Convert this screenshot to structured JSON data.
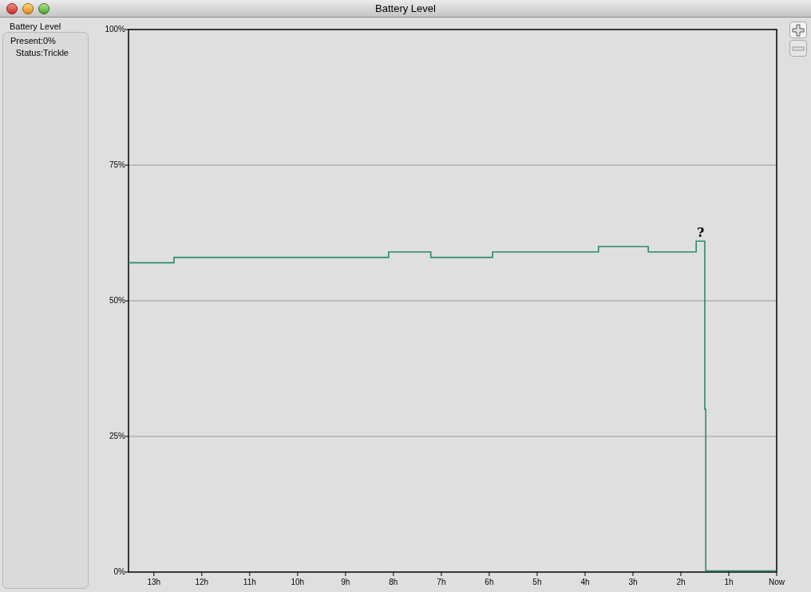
{
  "window": {
    "title": "Battery Level"
  },
  "sidebar": {
    "title": "Battery Level",
    "fields": [
      {
        "label": "Present:",
        "value": "0%"
      },
      {
        "label": "Status:",
        "value": "Trickle"
      }
    ]
  },
  "zoom_buttons": [
    {
      "kind": "zoom-in"
    },
    {
      "kind": "zoom-out"
    }
  ],
  "chart": {
    "chart_data": {
      "type": "line",
      "grid": true,
      "xlim": [
        -13.53,
        0
      ],
      "ylim": [
        0,
        100
      ],
      "xticks": [
        {
          "value": -13,
          "label": "13h"
        },
        {
          "value": -12,
          "label": "12h"
        },
        {
          "value": -11,
          "label": "11h"
        },
        {
          "value": -10,
          "label": "10h"
        },
        {
          "value": -9,
          "label": "9h"
        },
        {
          "value": -8,
          "label": "8h"
        },
        {
          "value": -7,
          "label": "7h"
        },
        {
          "value": -6,
          "label": "6h"
        },
        {
          "value": -5,
          "label": "5h"
        },
        {
          "value": -4,
          "label": "4h"
        },
        {
          "value": -3,
          "label": "3h"
        },
        {
          "value": -2,
          "label": "2h"
        },
        {
          "value": -1,
          "label": "1h"
        },
        {
          "value": 0,
          "label": "Now"
        }
      ],
      "yticks": [
        {
          "value": 0,
          "label": "0%"
        },
        {
          "value": 25,
          "label": "25%"
        },
        {
          "value": 50,
          "label": "50%"
        },
        {
          "value": 75,
          "label": "75%"
        },
        {
          "value": 100,
          "label": "100%"
        }
      ],
      "x": [
        -13.53,
        -12.58,
        -12.58,
        -8.1,
        -8.1,
        -7.22,
        -7.22,
        -5.93,
        -5.93,
        -3.72,
        -3.72,
        -2.68,
        -2.68,
        -1.68,
        -1.68,
        -1.5,
        -1.5,
        -1.48,
        -1.48,
        0
      ],
      "series": [
        {
          "color": "#2a8a6e",
          "values": [
            57,
            57,
            58,
            58,
            59,
            59,
            58,
            58,
            59,
            59,
            60,
            60,
            59,
            59,
            61,
            61,
            30,
            30,
            0,
            0
          ]
        }
      ],
      "annotations": [
        "?"
      ]
    }
  }
}
